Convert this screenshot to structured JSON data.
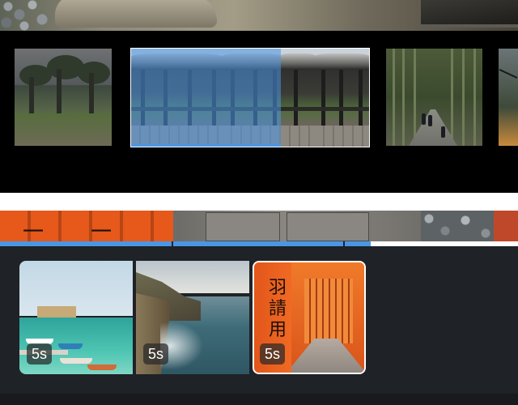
{
  "filmstrip": {
    "thumbnails": [
      {
        "name": "forest-path-thumbnail"
      },
      {
        "name": "pavilion-thumbnail",
        "selected": true
      },
      {
        "name": "bamboo-grove-thumbnail"
      },
      {
        "name": "cable-car-thumbnail"
      }
    ],
    "accent_color": "#4a96e6"
  },
  "timeline": {
    "progress_segments": 3,
    "clips": [
      {
        "name": "harbor-clip",
        "duration": "5s"
      },
      {
        "name": "coastline-clip",
        "duration": "5s"
      },
      {
        "name": "torii-gates-clip",
        "duration": "5s",
        "selected": true
      }
    ]
  }
}
